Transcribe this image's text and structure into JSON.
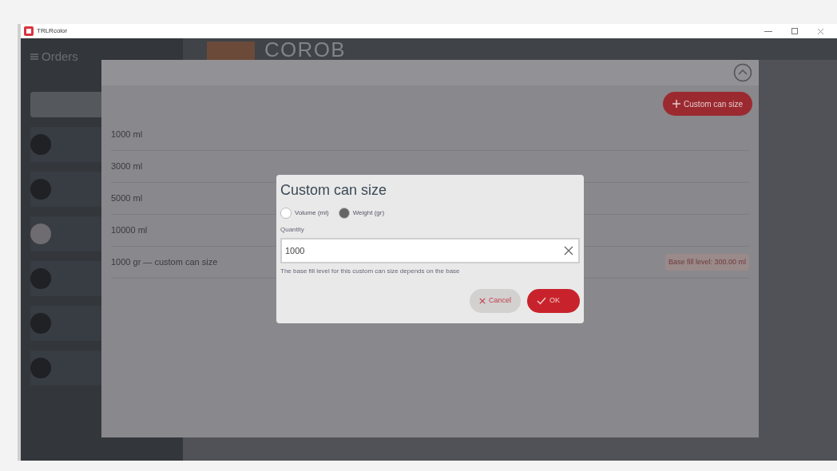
{
  "window": {
    "title": "TRLRcolor"
  },
  "header": {
    "logo": "COROB"
  },
  "sidebar": {
    "title": "Orders"
  },
  "modal": {
    "add_button": "Custom can size",
    "can_sizes": [
      {
        "label": "1000 ml"
      },
      {
        "label": "3000 ml"
      },
      {
        "label": "5000 ml"
      },
      {
        "label": "10000 ml"
      },
      {
        "label": "1000 gr — custom can size",
        "badge": "Base fill level: 300.00 ml"
      }
    ]
  },
  "dialog": {
    "title": "Custom can size",
    "units": [
      {
        "label": "Volume (ml)",
        "selected": false
      },
      {
        "label": "Weight (gr)",
        "selected": true
      }
    ],
    "quantity": {
      "label": "Quantity",
      "value": "1000"
    },
    "hint": "The base fill level for this custom can size depends on the base",
    "buttons": [
      {
        "kind": "cancel",
        "label": "Cancel"
      },
      {
        "kind": "ok",
        "label": "OK"
      }
    ]
  }
}
